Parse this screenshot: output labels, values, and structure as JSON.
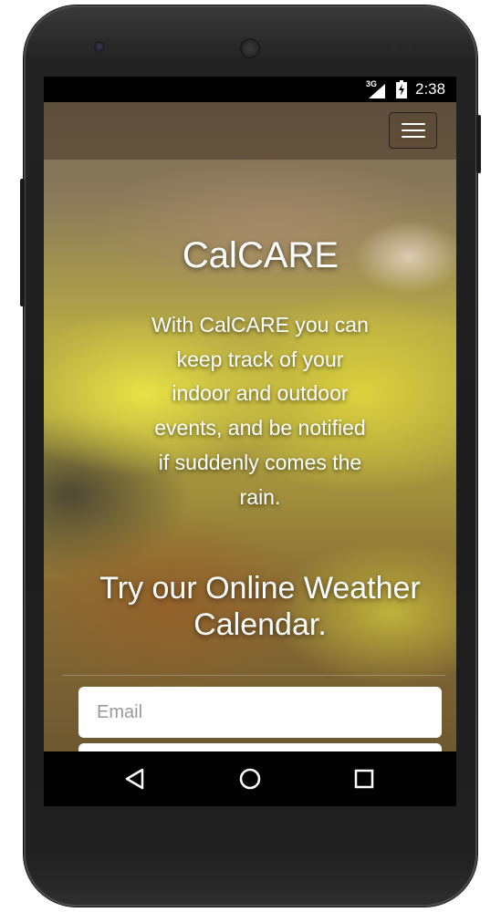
{
  "status_bar": {
    "network": "3G",
    "time": "2:38"
  },
  "navbar": {
    "menu_icon": "hamburger-menu-icon"
  },
  "hero": {
    "title": "CalCARE",
    "description": "With CalCARE you can keep track of your indoor and outdoor events, and be notified if suddenly comes the rain.",
    "cta": "Try our Online Weather Calendar."
  },
  "form": {
    "email_placeholder": "Email"
  },
  "system_nav": {
    "back_icon": "back-triangle-icon",
    "home_icon": "home-circle-icon",
    "recents_icon": "recents-square-icon"
  }
}
